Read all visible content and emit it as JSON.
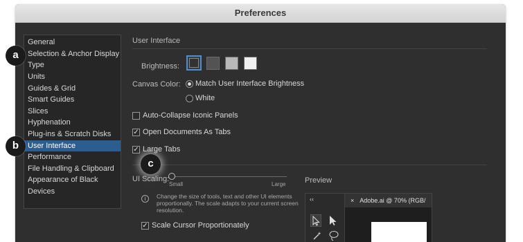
{
  "window": {
    "title": "Preferences"
  },
  "sidebar": {
    "items": [
      {
        "label": "General"
      },
      {
        "label": "Selection & Anchor Display"
      },
      {
        "label": "Type"
      },
      {
        "label": "Units"
      },
      {
        "label": "Guides & Grid"
      },
      {
        "label": "Smart Guides"
      },
      {
        "label": "Slices"
      },
      {
        "label": "Hyphenation"
      },
      {
        "label": "Plug-ins & Scratch Disks"
      },
      {
        "label": "User Interface",
        "selected": true
      },
      {
        "label": "Performance"
      },
      {
        "label": "File Handling & Clipboard"
      },
      {
        "label": "Appearance of Black"
      },
      {
        "label": "Devices"
      }
    ]
  },
  "panel": {
    "section_title": "User Interface",
    "brightness_label": "Brightness:",
    "brightness_selected": "darkest",
    "brightness_colors": [
      "#323232",
      "#535353",
      "#b8b8b8",
      "#f0f0f0"
    ],
    "canvas_color_label": "Canvas Color:",
    "canvas_options": [
      {
        "label": "Match User Interface Brightness",
        "selected": true
      },
      {
        "label": "White",
        "selected": false
      }
    ],
    "checkboxes": [
      {
        "label": "Auto-Collapse Iconic Panels",
        "checked": false
      },
      {
        "label": "Open Documents As Tabs",
        "checked": true
      },
      {
        "label": "Large Tabs",
        "checked": true
      }
    ],
    "ui_scaling": {
      "label": "UI Scaling:",
      "min_label": "Small",
      "max_label": "Large",
      "value_fraction": 0.0,
      "info_icon": "info-icon",
      "description": "Change the size of tools, text and other UI elements proportionally. The scale adapts to your current screen resolution.",
      "scale_cursor_label": "Scale Cursor Proportionately",
      "scale_cursor_checked": true
    },
    "preview": {
      "label": "Preview",
      "collapse_glyph": "‹‹",
      "close_glyph": "×",
      "tab_title": "Adobe.ai @ 70% (RGB/"
    }
  },
  "annotations": {
    "a": "a",
    "b": "b",
    "c": "c"
  }
}
